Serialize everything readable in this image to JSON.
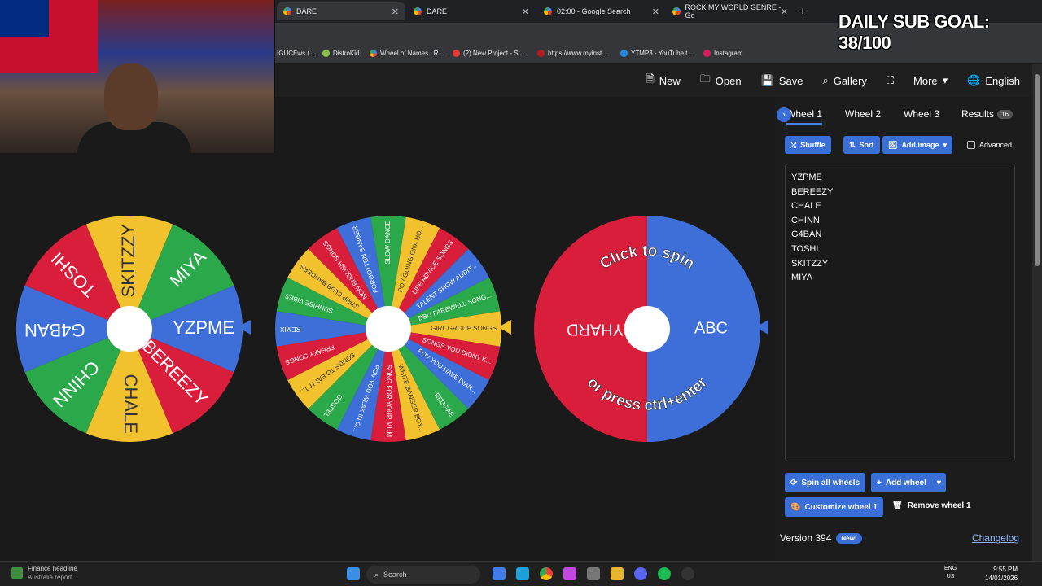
{
  "browser": {
    "tabs": [
      {
        "label": "DARE"
      },
      {
        "label": "DARE"
      },
      {
        "label": "02:00 - Google Search"
      },
      {
        "label": "ROCK MY WORLD GENRE - Go"
      }
    ],
    "bookmarks": [
      "IGUCEws (...",
      "DistroKid",
      "Wheel of Names | R...",
      "(2) New Project - St...",
      "https://www.myinst...",
      "YTMP3 - YouTube t...",
      "Instagram"
    ]
  },
  "overlay": {
    "sub_goal": "DAILY SUB GOAL: 38/100"
  },
  "menu": {
    "new": "New",
    "open": "Open",
    "save": "Save",
    "gallery": "Gallery",
    "more": "More",
    "language": "English"
  },
  "wheels": {
    "wheel1": {
      "names": [
        "YZPME",
        "BEREEZY",
        "CHALE",
        "CHINN",
        "G4BAN",
        "TOSHI",
        "SKITZZY",
        "MIYA"
      ],
      "colors": [
        "#3e6fd8",
        "#d91e3c",
        "#f2c12e",
        "#2ba84a",
        "#3e6fd8",
        "#d91e3c",
        "#f2c12e",
        "#2ba84a"
      ]
    },
    "wheel2": {
      "names": [
        "GIRL GROUP SONGS",
        "SONGS YOU DIDNT K...",
        "POV YOU HAVE DIAR...",
        "REGGAE",
        "WHITE BANGER BOY...",
        "SONG FOR YOUR MUM",
        "POV YOU WLAK IN O...",
        "GOSPEL",
        "SONGS TO EAT IT T...",
        "FREAKY SONGS",
        "REMIX",
        "SUNRISE VIBES",
        "STRIP CLUB BANGERS",
        "NON ENGLISH SONGS",
        "FORGOTTEN BANGER",
        "SLOW DANCE",
        "POV GOING ONA HO...",
        "LIFE ADVICE SONGS",
        "TALENT SHOW AUDIT...",
        "DBU FAREWELL SONG..."
      ],
      "colors": [
        "#f2c12e",
        "#d91e3c",
        "#3e6fd8",
        "#2ba84a",
        "#f2c12e",
        "#d91e3c",
        "#3e6fd8",
        "#2ba84a",
        "#f2c12e",
        "#d91e3c",
        "#3e6fd8",
        "#2ba84a",
        "#f2c12e",
        "#d91e3c",
        "#3e6fd8",
        "#2ba84a",
        "#f2c12e",
        "#d91e3c",
        "#3e6fd8",
        "#2ba84a"
      ]
    },
    "wheel3": {
      "names": [
        "ABC",
        "TRYHARD"
      ],
      "colors": [
        "#3e6fd8",
        "#d91e3c"
      ],
      "hint_top": "Click to spin",
      "hint_bottom": "or press ctrl+enter"
    }
  },
  "panel": {
    "tabs": {
      "wheel1": "Wheel 1",
      "wheel2": "Wheel 2",
      "wheel3": "Wheel 3",
      "results": "Results",
      "results_count": "16"
    },
    "shuffle": "Shuffle",
    "sort": "Sort",
    "add_image": "Add image",
    "advanced": "Advanced",
    "spin_all": "Spin all wheels",
    "add_wheel": "Add wheel",
    "customize": "Customize wheel 1",
    "remove": "Remove wheel 1",
    "version": "Version 394",
    "new_badge": "New!",
    "changelog": "Changelog"
  },
  "taskbar": {
    "news_title": "Finance headline",
    "news_sub": "Australia report...",
    "search": "Search",
    "lang_top": "ENG",
    "lang_bottom": "US",
    "time": "9:55 PM",
    "date": "14/01/2026"
  }
}
